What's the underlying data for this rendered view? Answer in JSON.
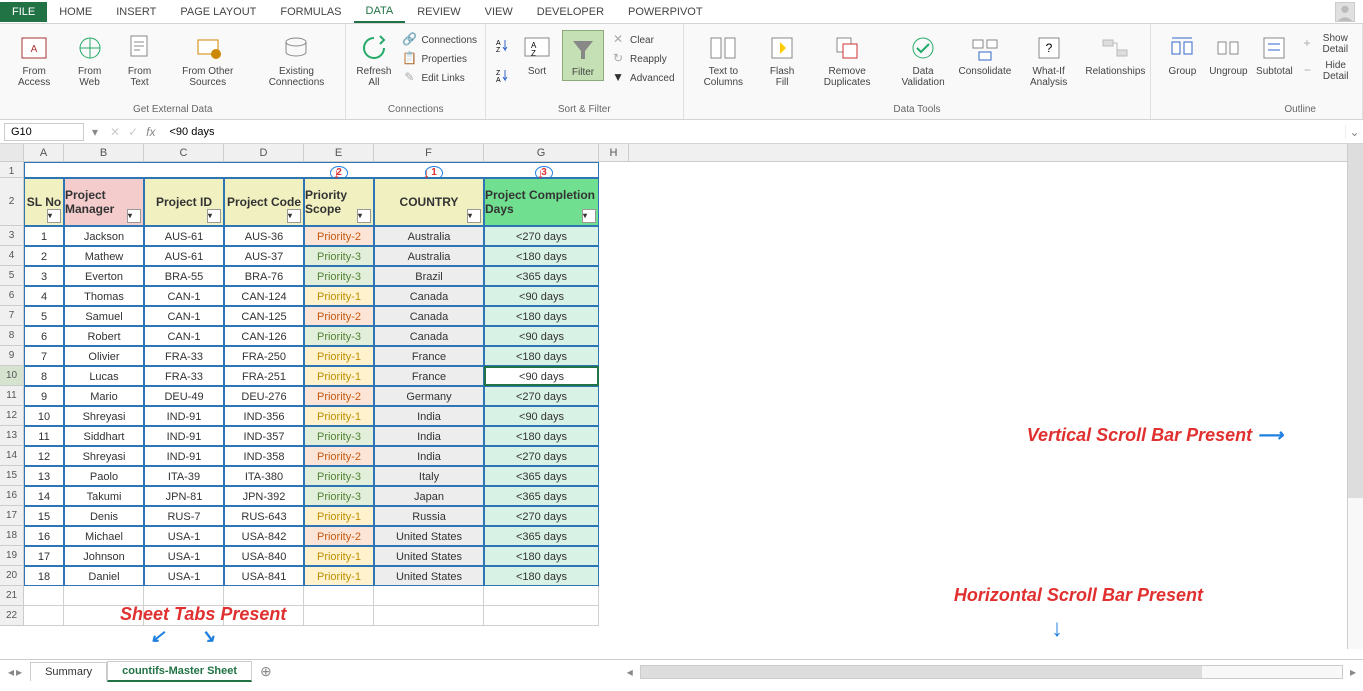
{
  "tabs": {
    "file": "FILE",
    "items": [
      "HOME",
      "INSERT",
      "PAGE LAYOUT",
      "FORMULAS",
      "DATA",
      "REVIEW",
      "VIEW",
      "DEVELOPER",
      "POWERPIVOT"
    ],
    "active": "DATA"
  },
  "ribbon": {
    "get_external": {
      "label": "Get External Data",
      "from_access": "From Access",
      "from_web": "From Web",
      "from_text": "From Text",
      "from_other": "From Other Sources",
      "existing": "Existing Connections"
    },
    "connections": {
      "label": "Connections",
      "refresh": "Refresh All",
      "connections": "Connections",
      "properties": "Properties",
      "edit_links": "Edit Links"
    },
    "sort_filter": {
      "label": "Sort & Filter",
      "sort": "Sort",
      "filter": "Filter",
      "clear": "Clear",
      "reapply": "Reapply",
      "advanced": "Advanced"
    },
    "data_tools": {
      "label": "Data Tools",
      "text_to_columns": "Text to Columns",
      "flash_fill": "Flash Fill",
      "remove_duplicates": "Remove Duplicates",
      "data_validation": "Data Validation",
      "consolidate": "Consolidate",
      "what_if": "What-If Analysis",
      "relationships": "Relationships"
    },
    "outline": {
      "label": "Outline",
      "group": "Group",
      "ungroup": "Ungroup",
      "subtotal": "Subtotal",
      "show_detail": "Show Detail",
      "hide_detail": "Hide Detail"
    }
  },
  "formula_bar": {
    "cell_ref": "G10",
    "formula": "<90 days"
  },
  "columns": [
    "A",
    "B",
    "C",
    "D",
    "E",
    "F",
    "G",
    "H"
  ],
  "table": {
    "headers": {
      "sl": "SL No",
      "pm": "Project Manager",
      "pid": "Project ID",
      "pcode": "Project Code",
      "scope": "Priority Scope",
      "country": "COUNTRY",
      "completion": "Project Completion Days"
    },
    "rows": [
      {
        "n": "1",
        "pm": "Jackson",
        "pid": "AUS-61",
        "code": "AUS-36",
        "prio": "Priority-2",
        "country": "Australia",
        "comp": "<270 days"
      },
      {
        "n": "2",
        "pm": "Mathew",
        "pid": "AUS-61",
        "code": "AUS-37",
        "prio": "Priority-3",
        "country": "Australia",
        "comp": "<180 days"
      },
      {
        "n": "3",
        "pm": "Everton",
        "pid": "BRA-55",
        "code": "BRA-76",
        "prio": "Priority-3",
        "country": "Brazil",
        "comp": "<365 days"
      },
      {
        "n": "4",
        "pm": "Thomas",
        "pid": "CAN-1",
        "code": "CAN-124",
        "prio": "Priority-1",
        "country": "Canada",
        "comp": "<90 days"
      },
      {
        "n": "5",
        "pm": "Samuel",
        "pid": "CAN-1",
        "code": "CAN-125",
        "prio": "Priority-2",
        "country": "Canada",
        "comp": "<180 days"
      },
      {
        "n": "6",
        "pm": "Robert",
        "pid": "CAN-1",
        "code": "CAN-126",
        "prio": "Priority-3",
        "country": "Canada",
        "comp": "<90 days"
      },
      {
        "n": "7",
        "pm": "Olivier",
        "pid": "FRA-33",
        "code": "FRA-250",
        "prio": "Priority-1",
        "country": "France",
        "comp": "<180 days"
      },
      {
        "n": "8",
        "pm": "Lucas",
        "pid": "FRA-33",
        "code": "FRA-251",
        "prio": "Priority-1",
        "country": "France",
        "comp": "<90 days"
      },
      {
        "n": "9",
        "pm": "Mario",
        "pid": "DEU-49",
        "code": "DEU-276",
        "prio": "Priority-2",
        "country": "Germany",
        "comp": "<270 days"
      },
      {
        "n": "10",
        "pm": "Shreyasi",
        "pid": "IND-91",
        "code": "IND-356",
        "prio": "Priority-1",
        "country": "India",
        "comp": "<90 days"
      },
      {
        "n": "11",
        "pm": "Siddhart",
        "pid": "IND-91",
        "code": "IND-357",
        "prio": "Priority-3",
        "country": "India",
        "comp": "<180 days"
      },
      {
        "n": "12",
        "pm": "Shreyasi",
        "pid": "IND-91",
        "code": "IND-358",
        "prio": "Priority-2",
        "country": "India",
        "comp": "<270 days"
      },
      {
        "n": "13",
        "pm": "Paolo",
        "pid": "ITA-39",
        "code": "ITA-380",
        "prio": "Priority-3",
        "country": "Italy",
        "comp": "<365 days"
      },
      {
        "n": "14",
        "pm": "Takumi",
        "pid": "JPN-81",
        "code": "JPN-392",
        "prio": "Priority-3",
        "country": "Japan",
        "comp": "<365 days"
      },
      {
        "n": "15",
        "pm": "Denis",
        "pid": "RUS-7",
        "code": "RUS-643",
        "prio": "Priority-1",
        "country": "Russia",
        "comp": "<270 days"
      },
      {
        "n": "16",
        "pm": "Michael",
        "pid": "USA-1",
        "code": "USA-842",
        "prio": "Priority-2",
        "country": "United States",
        "comp": "<365 days"
      },
      {
        "n": "17",
        "pm": "Johnson",
        "pid": "USA-1",
        "code": "USA-840",
        "prio": "Priority-1",
        "country": "United States",
        "comp": "<180 days"
      },
      {
        "n": "18",
        "pm": "Daniel",
        "pid": "USA-1",
        "code": "USA-841",
        "prio": "Priority-1",
        "country": "United States",
        "comp": "<180 days"
      }
    ]
  },
  "callouts": {
    "c1": "1",
    "c2": "2",
    "c3": "3"
  },
  "annotations": {
    "vscroll": "Vertical Scroll Bar Present",
    "hscroll": "Horizontal Scroll Bar Present",
    "sheets": "Sheet Tabs Present"
  },
  "sheets": {
    "summary": "Summary",
    "master": "countifs-Master Sheet"
  }
}
